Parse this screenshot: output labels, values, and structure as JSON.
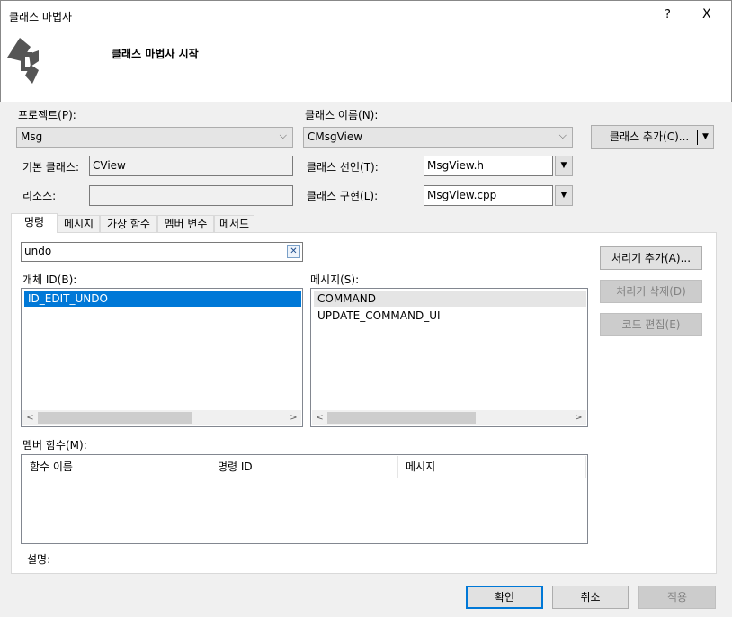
{
  "window": {
    "title": "클래스 마법사",
    "help": "?",
    "close": "X"
  },
  "header": {
    "title": "클래스 마법사 시작"
  },
  "form": {
    "project_label": "프로젝트(P):",
    "project_value": "Msg",
    "class_name_label": "클래스 이름(N):",
    "class_name_value": "CMsgView",
    "add_class_label": "클래스 추가(C)...",
    "base_class_label": "기본 클래스:",
    "base_class_value": "CView",
    "resource_label": "리소스:",
    "resource_value": "",
    "class_decl_label": "클래스 선언(T):",
    "class_decl_value": "MsgView.h",
    "class_impl_label": "클래스 구현(L):",
    "class_impl_value": "MsgView.cpp"
  },
  "tabs": [
    {
      "label": "명령"
    },
    {
      "label": "메시지"
    },
    {
      "label": "가상 함수"
    },
    {
      "label": "멤버 변수"
    },
    {
      "label": "메서드"
    }
  ],
  "commands": {
    "search_value": "undo",
    "object_ids_label": "개체 ID(B):",
    "object_ids": [
      "ID_EDIT_UNDO"
    ],
    "messages_label": "메시지(S):",
    "messages": [
      "COMMAND",
      "UPDATE_COMMAND_UI"
    ],
    "add_handler": "처리기 추가(A)...",
    "delete_handler": "처리기 삭제(D)",
    "edit_code": "코드 편집(E)",
    "member_functions_label": "멤버 함수(M):",
    "columns": [
      "함수 이름",
      "명령 ID",
      "메시지"
    ],
    "description_label": "설명:"
  },
  "footer": {
    "ok": "확인",
    "cancel": "취소",
    "apply": "적용"
  },
  "colors": {
    "selection": "#0078d7",
    "hover": "#e5e5e5"
  }
}
